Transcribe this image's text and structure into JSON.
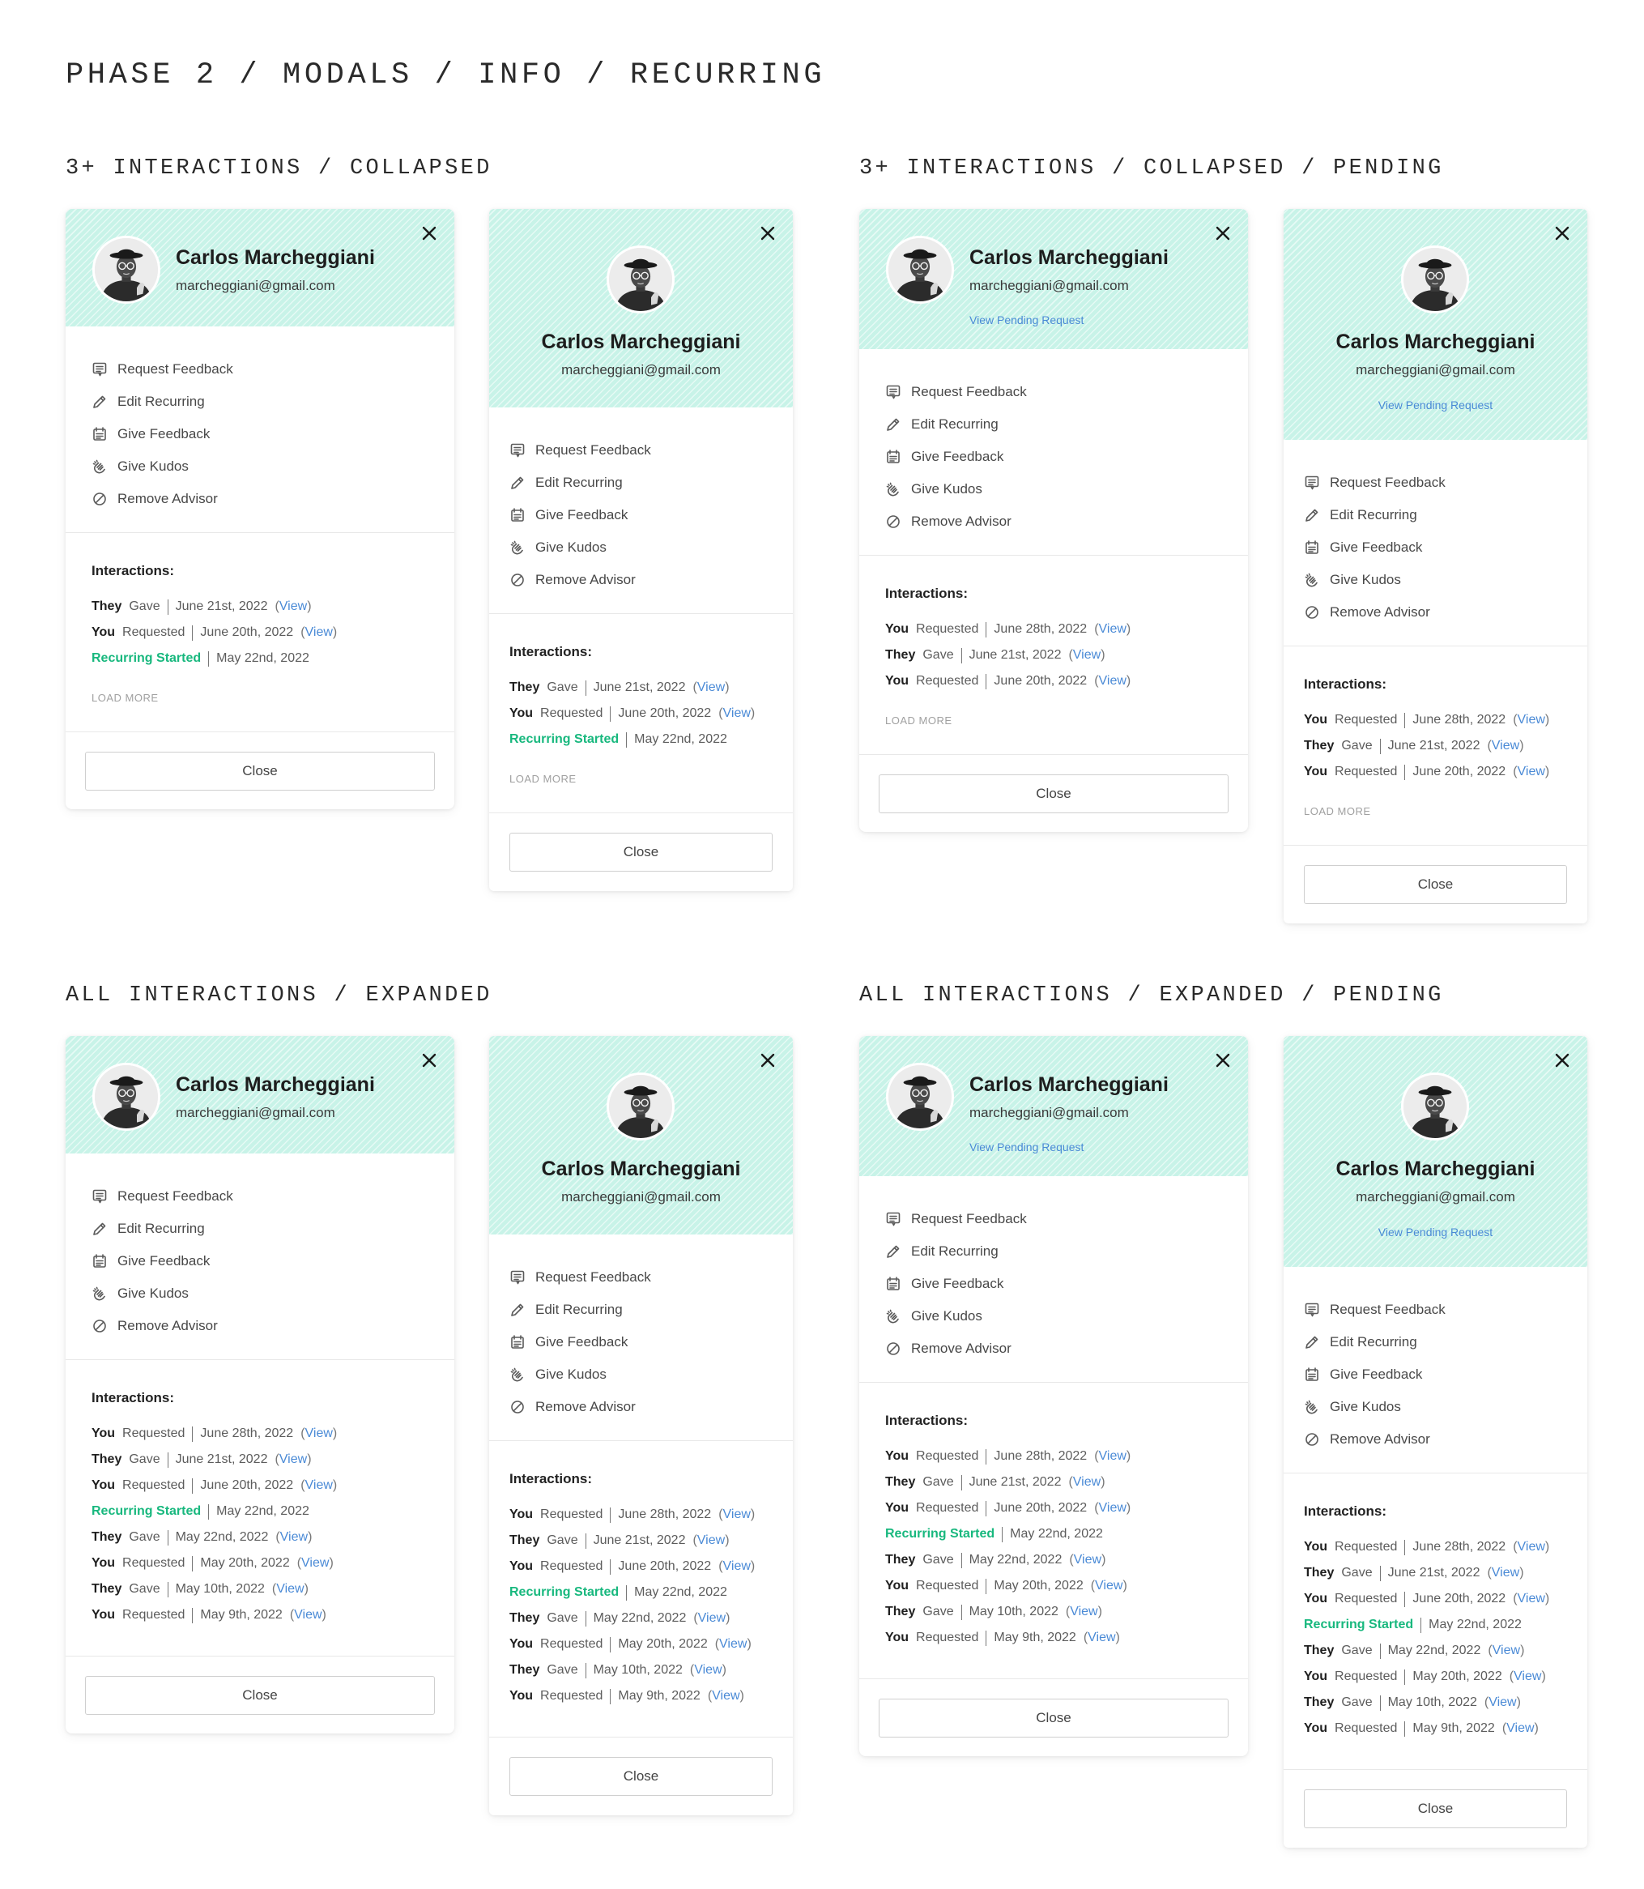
{
  "page": {
    "title": "PHASE 2 / MODALS / INFO / RECURRING"
  },
  "sections": [
    {
      "title": "3+ INTERACTIONS / COLLAPSED"
    },
    {
      "title": "3+ INTERACTIONS / COLLAPSED / PENDING"
    },
    {
      "title": "ALL INTERACTIONS / EXPANDED"
    },
    {
      "title": "ALL INTERACTIONS / EXPANDED / PENDING"
    }
  ],
  "person": {
    "name": "Carlos Marcheggiani",
    "email": "marcheggiani@gmail.com",
    "pending_link": "View Pending Request"
  },
  "icons": {
    "close": "close-icon",
    "avatar": "avatar-photo",
    "actions": [
      "request-feedback-icon",
      "edit-pencil-icon",
      "give-feedback-icon",
      "kudos-hand-icon",
      "remove-circle-slash-icon"
    ]
  },
  "colors": {
    "header_bg": "#c8f3e8",
    "link": "#4a8ad6",
    "recurring_started": "#18b87e"
  },
  "actions": [
    "Request Feedback",
    "Edit Recurring",
    "Give Feedback",
    "Give Kudos",
    "Remove Advisor"
  ],
  "interactions_title": "Interactions:",
  "load_more": "LOAD MORE",
  "close_label": "Close",
  "interactions": {
    "collapsed": [
      {
        "actor": "They",
        "verb": "Gave",
        "date": "June 21st, 2022",
        "view": "View"
      },
      {
        "actor": "You",
        "verb": "Requested",
        "date": "June 20th, 2022",
        "view": "View"
      },
      {
        "actor": "",
        "verb": "Recurring Started",
        "date": "May 22nd, 2022",
        "view": ""
      }
    ],
    "collapsed_pending": [
      {
        "actor": "You",
        "verb": "Requested",
        "date": "June 28th, 2022",
        "view": "View"
      },
      {
        "actor": "They",
        "verb": "Gave",
        "date": "June 21st, 2022",
        "view": "View"
      },
      {
        "actor": "You",
        "verb": "Requested",
        "date": "June 20th, 2022",
        "view": "View"
      }
    ],
    "expanded": [
      {
        "actor": "You",
        "verb": "Requested",
        "date": "June 28th, 2022",
        "view": "View"
      },
      {
        "actor": "They",
        "verb": "Gave",
        "date": "June 21st, 2022",
        "view": "View"
      },
      {
        "actor": "You",
        "verb": "Requested",
        "date": "June 20th, 2022",
        "view": "View"
      },
      {
        "actor": "",
        "verb": "Recurring Started",
        "date": "May 22nd, 2022",
        "view": ""
      },
      {
        "actor": "They",
        "verb": "Gave",
        "date": "May 22nd, 2022",
        "view": "View"
      },
      {
        "actor": "You",
        "verb": "Requested",
        "date": "May 20th, 2022",
        "view": "View"
      },
      {
        "actor": "They",
        "verb": "Gave",
        "date": "May 10th, 2022",
        "view": "View"
      },
      {
        "actor": "You",
        "verb": "Requested",
        "date": "May 9th, 2022",
        "view": "View"
      }
    ]
  },
  "cards": [
    {
      "variant": "wide",
      "pending": false,
      "interactions": "collapsed",
      "load_more": true
    },
    {
      "variant": "narrow",
      "pending": false,
      "interactions": "collapsed",
      "load_more": true
    },
    {
      "variant": "wide",
      "pending": true,
      "interactions": "collapsed_pending",
      "load_more": true
    },
    {
      "variant": "narrow",
      "pending": true,
      "interactions": "collapsed_pending",
      "load_more": true
    },
    {
      "variant": "wide",
      "pending": false,
      "interactions": "expanded",
      "load_more": false
    },
    {
      "variant": "narrow",
      "pending": false,
      "interactions": "expanded",
      "load_more": false
    },
    {
      "variant": "wide",
      "pending": true,
      "interactions": "expanded",
      "load_more": false
    },
    {
      "variant": "narrow",
      "pending": true,
      "interactions": "expanded",
      "load_more": false
    }
  ]
}
